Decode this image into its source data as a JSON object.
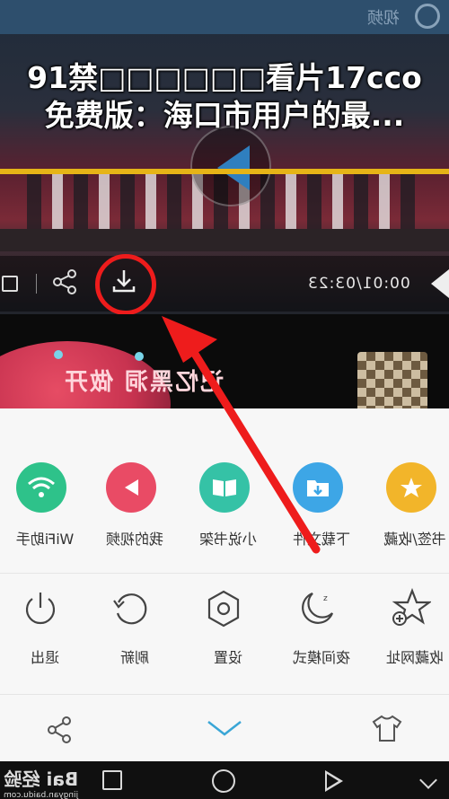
{
  "top_strip": {
    "label": "视频"
  },
  "headline": {
    "line1": "91禁□□□□□□看片17cco",
    "line2": "免费版：海口市用户的最..."
  },
  "video": {
    "time": "00:01/03:23",
    "overlay_text": "记忆黑洞 做开"
  },
  "menu": {
    "row1": [
      {
        "label": "WiFi助手",
        "icon": "wifi-icon",
        "color": "#2ec28a"
      },
      {
        "label": "我的视频",
        "icon": "play-left-icon",
        "color": "#e94b65"
      },
      {
        "label": "小说书架",
        "icon": "book-icon",
        "color": "#35c2a6"
      },
      {
        "label": "下载文件",
        "icon": "download-folder-icon",
        "color": "#3da6e6"
      },
      {
        "label": "书签/收藏",
        "icon": "star-icon",
        "color": "#f2b52a"
      }
    ],
    "row2": [
      {
        "label": "退出",
        "icon": "power-icon"
      },
      {
        "label": "刷新",
        "icon": "refresh-icon"
      },
      {
        "label": "设置",
        "icon": "gear-icon"
      },
      {
        "label": "夜间模式",
        "icon": "moon-icon"
      },
      {
        "label": "收藏网址",
        "icon": "star-add-icon"
      }
    ]
  },
  "watermark": {
    "main": "Bai 经验",
    "sub": "jingyan.baidu.com"
  },
  "colors": {
    "annotation_red": "#ee1c1c",
    "accent_yellow": "#e6b417",
    "sheet_bg": "#f7f7f7"
  }
}
